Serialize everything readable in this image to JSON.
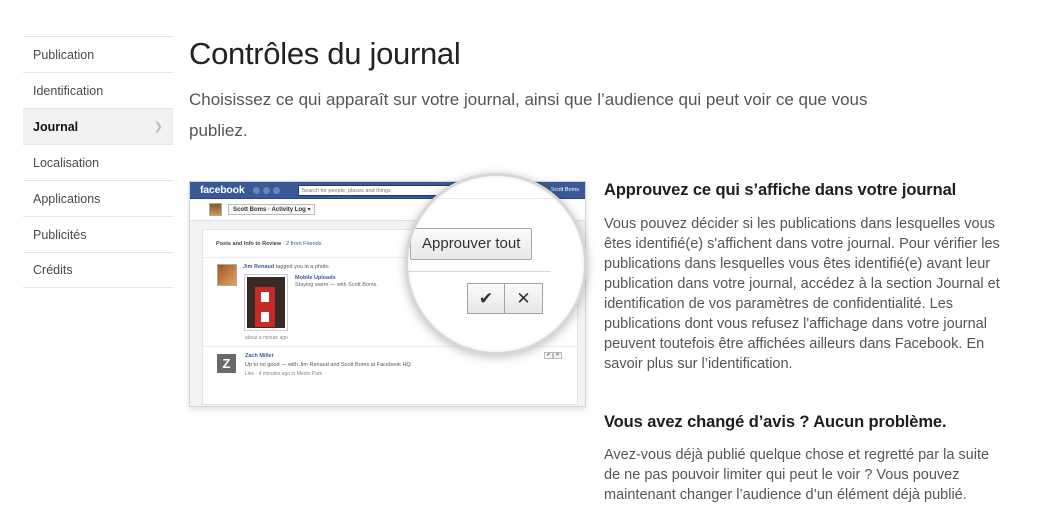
{
  "sidebar": {
    "items": [
      {
        "label": "Publication"
      },
      {
        "label": "Identification"
      },
      {
        "label": "Journal",
        "active": true
      },
      {
        "label": "Localisation"
      },
      {
        "label": "Applications"
      },
      {
        "label": "Publicités"
      },
      {
        "label": "Crédits"
      }
    ]
  },
  "header": {
    "title": "Contrôles du journal",
    "subtitle": "Choisissez ce qui apparaît sur votre journal, ainsi que l’audience qui peut voir ce que vous publiez."
  },
  "illustration": {
    "logo": "facebook",
    "search_placeholder": "Search for people, places and things",
    "profile_name": "Scott Boms",
    "activity_log": "Scott Boms · Activity Log ▾",
    "panel_title": "Posts and Info to Review",
    "panel_title_link": "· 2 from Friends",
    "post1": {
      "author": "Jim Renaud",
      "action": " tagged you in a photo.",
      "album": "Mobile Uploads",
      "caption": "Staying warm — with Scott Boms.",
      "meta": "about a minute ago"
    },
    "post2": {
      "author": "Zach Miller",
      "text": "Up to no good — with Jim Renaud and Scott Boms at Facebook HQ.",
      "meta": "Like · 4 minutes ago in Menlo Park"
    },
    "magnifier": {
      "approve_label": "Approuver tout",
      "accept_glyph": "✔",
      "reject_glyph": "✕"
    }
  },
  "sections": [
    {
      "title": "Approuvez ce qui s’affiche dans votre journal",
      "body": "Vous pouvez décider si les publications dans lesquelles vous êtes identifié(e) s'affichent dans votre journal. Pour vérifier les publications dans lesquelles vous êtes identifié(e) avant leur publication dans votre journal, accédez à la section Journal et identification de vos paramètres de confidentialité. Les publications dont vous refusez l'affichage dans votre journal peuvent toutefois être affichées ailleurs dans Facebook. En savoir plus sur l’identification."
    },
    {
      "title": "Vous avez changé d’avis ? Aucun problème.",
      "body": "Avez-vous déjà publié quelque chose et regretté par la suite de ne pas pouvoir limiter qui peut le voir ? Vous pouvez maintenant changer l’audience d’un élément déjà publié."
    }
  ]
}
